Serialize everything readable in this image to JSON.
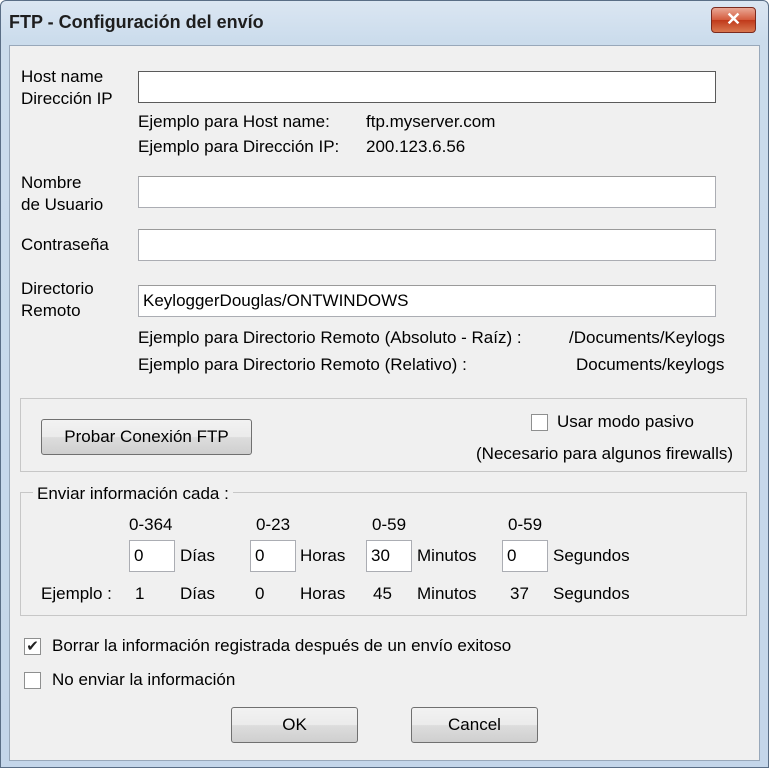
{
  "window": {
    "title": "FTP - Configuración del envío",
    "close_glyph": "✕"
  },
  "host": {
    "label_line1": "Host name",
    "label_line2": "Dirección IP",
    "value": "",
    "example_host_label": "Ejemplo para Host name:",
    "example_host_value": "ftp.myserver.com",
    "example_ip_label": "Ejemplo para Dirección IP:",
    "example_ip_value": "200.123.6.56"
  },
  "user": {
    "label_line1": "Nombre",
    "label_line2": "de Usuario",
    "value": ""
  },
  "password": {
    "label": "Contraseña",
    "value": ""
  },
  "remote_dir": {
    "label_line1": "Directorio",
    "label_line2": "Remoto",
    "value": "KeyloggerDouglas/ONTWINDOWS",
    "example_abs_label": "Ejemplo para Directorio Remoto (Absoluto - Raíz) :",
    "example_abs_value": "/Documents/Keylogs",
    "example_rel_label": "Ejemplo para Directorio Remoto (Relativo) :",
    "example_rel_value": "Documents/keylogs"
  },
  "connection": {
    "test_button": "Probar Conexión FTP",
    "passive_label": "Usar modo pasivo",
    "passive_checked": false,
    "passive_note": "(Necesario para algunos firewalls)"
  },
  "interval": {
    "legend": "Enviar información cada :",
    "fields": [
      {
        "range": "0-364",
        "value": "0",
        "unit": "Días",
        "example": "1"
      },
      {
        "range": "0-23",
        "value": "0",
        "unit": "Horas",
        "example": "0"
      },
      {
        "range": "0-59",
        "value": "30",
        "unit": "Minutos",
        "example": "45"
      },
      {
        "range": "0-59",
        "value": "0",
        "unit": "Segundos",
        "example": "37"
      }
    ],
    "example_label": "Ejemplo :"
  },
  "options": {
    "delete_after_send": {
      "label": "Borrar la información registrada después de un envío exitoso",
      "checked": true
    },
    "do_not_send": {
      "label": "No enviar la información",
      "checked": false
    }
  },
  "buttons": {
    "ok": "OK",
    "cancel": "Cancel"
  },
  "checkmark_glyph": "✔"
}
